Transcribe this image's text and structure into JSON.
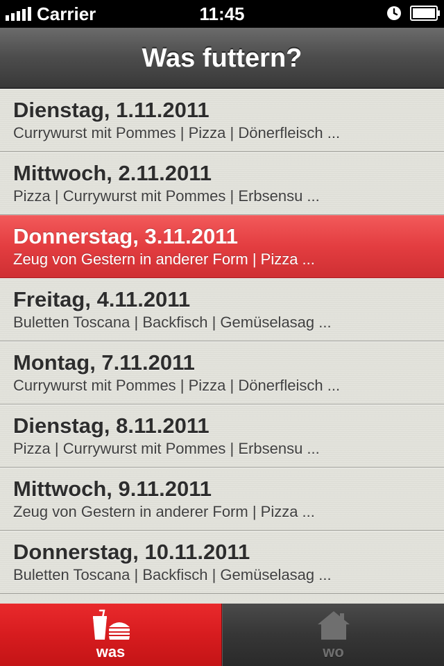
{
  "status_bar": {
    "carrier": "Carrier",
    "time": "11:45",
    "icons": [
      "signal-icon",
      "alarm-icon",
      "battery-icon"
    ]
  },
  "nav": {
    "title": "Was futtern?"
  },
  "list": {
    "items": [
      {
        "title": "Dienstag, 1.11.2011",
        "subtitle": "Currywurst mit Pommes | Pizza | Dönerfleisch ..."
      },
      {
        "title": "Mittwoch, 2.11.2011",
        "subtitle": "Pizza | Currywurst mit Pommes | Erbsensu ..."
      },
      {
        "title": "Donnerstag, 3.11.2011",
        "subtitle": "Zeug von Gestern in anderer Form | Pizza ...",
        "selected": true
      },
      {
        "title": "Freitag, 4.11.2011",
        "subtitle": "Buletten Toscana | Backfisch | Gemüselasag ..."
      },
      {
        "title": "Montag, 7.11.2011",
        "subtitle": "Currywurst mit Pommes | Pizza | Dönerfleisch ..."
      },
      {
        "title": "Dienstag, 8.11.2011",
        "subtitle": "Pizza | Currywurst mit Pommes | Erbsensu ..."
      },
      {
        "title": "Mittwoch, 9.11.2011",
        "subtitle": "Zeug von Gestern in anderer Form | Pizza ..."
      },
      {
        "title": "Donnerstag, 10.11.2011",
        "subtitle": "Buletten Toscana | Backfisch | Gemüselasag ..."
      }
    ]
  },
  "tabs": [
    {
      "label": "was",
      "icon": "drink-burger-icon",
      "active": true
    },
    {
      "label": "wo",
      "icon": "house-icon",
      "active": false
    }
  ],
  "colors": {
    "accent": "#e33d40",
    "tab_active": "#d71c1f",
    "nav_bar": "#4c4c4c",
    "list_bg": "#e3e3dc"
  }
}
